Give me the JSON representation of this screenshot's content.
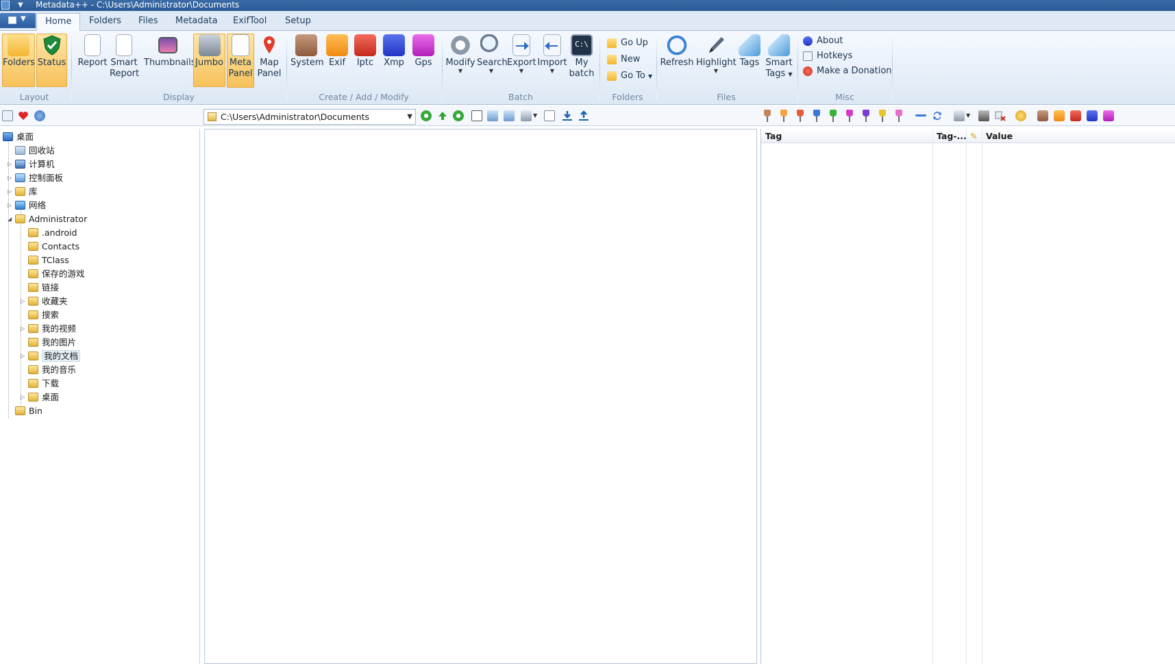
{
  "window": {
    "title": "Metadata++ - C:\\Users\\Administrator\\Documents"
  },
  "ribbon_tabs": [
    "Home",
    "Folders",
    "Files",
    "Metadata",
    "ExifTool",
    "Setup"
  ],
  "ribbon": {
    "layout": {
      "label": "Layout",
      "folders": "Folders",
      "status": "Status"
    },
    "display": {
      "label": "Display",
      "report": "Report",
      "smart": "Smart",
      "report2": "Report",
      "thumbnails": "Thumbnails",
      "jumbo": "Jumbo",
      "meta": "Meta",
      "panel": "Panel",
      "map": "Map",
      "panel2": "Panel"
    },
    "create": {
      "label": "Create / Add / Modify",
      "system": "System",
      "exif": "Exif",
      "iptc": "Iptc",
      "xmp": "Xmp",
      "gps": "Gps"
    },
    "batch": {
      "label": "Batch",
      "modify": "Modify",
      "search": "Search",
      "export": "Export",
      "import": "Import",
      "my": "My",
      "batch": "batch",
      "cmd": "C:\\"
    },
    "folders": {
      "label": "Folders",
      "go_up": "Go Up",
      "new": "New",
      "go_to": "Go To"
    },
    "files": {
      "label": "Files",
      "refresh": "Refresh",
      "highlight": "Highlight",
      "tags": "Tags",
      "smart": "Smart",
      "tags2": "Tags"
    },
    "misc": {
      "label": "Misc",
      "about": "About",
      "hotkeys": "Hotkeys",
      "donation": "Make a Donation"
    }
  },
  "toolbar": {
    "path": "C:\\Users\\Administrator\\Documents"
  },
  "tree": [
    {
      "label": "桌面",
      "level": 0
    },
    {
      "label": "回收站",
      "level": 1
    },
    {
      "label": "计算机",
      "level": 1
    },
    {
      "label": "控制面板",
      "level": 1
    },
    {
      "label": "库",
      "level": 1
    },
    {
      "label": "网络",
      "level": 1
    },
    {
      "label": "Administrator",
      "level": 1
    },
    {
      "label": ".android",
      "level": 2
    },
    {
      "label": "Contacts",
      "level": 2
    },
    {
      "label": "TClass",
      "level": 2
    },
    {
      "label": "保存的游戏",
      "level": 2
    },
    {
      "label": "链接",
      "level": 2
    },
    {
      "label": "收藏夹",
      "level": 2
    },
    {
      "label": "搜索",
      "level": 2
    },
    {
      "label": "我的视频",
      "level": 2
    },
    {
      "label": "我的图片",
      "level": 2
    },
    {
      "label": "我的文档",
      "level": 2
    },
    {
      "label": "我的音乐",
      "level": 2
    },
    {
      "label": "下载",
      "level": 2
    },
    {
      "label": "桌面",
      "level": 2
    },
    {
      "label": "Bin",
      "level": 1
    }
  ],
  "metadata_panel": {
    "col_tag": "Tag",
    "col_tag_type": "Tag-...",
    "col_value": "Value"
  }
}
